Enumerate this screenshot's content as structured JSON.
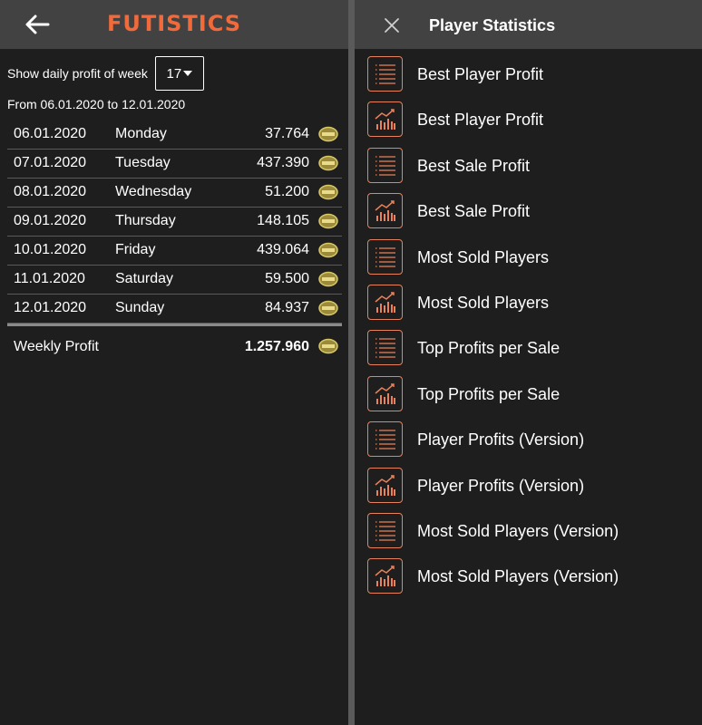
{
  "app": {
    "brand": "FUTISTICS"
  },
  "week": {
    "label": "Show daily profit of week",
    "selected": "17",
    "range": "From 06.01.2020 to 12.01.2020"
  },
  "days": [
    {
      "date": "06.01.2020",
      "day": "Monday",
      "amount": "37.764"
    },
    {
      "date": "07.01.2020",
      "day": "Tuesday",
      "amount": "437.390"
    },
    {
      "date": "08.01.2020",
      "day": "Wednesday",
      "amount": "51.200"
    },
    {
      "date": "09.01.2020",
      "day": "Thursday",
      "amount": "148.105"
    },
    {
      "date": "10.01.2020",
      "day": "Friday",
      "amount": "439.064"
    },
    {
      "date": "11.01.2020",
      "day": "Saturday",
      "amount": "59.500"
    },
    {
      "date": "12.01.2020",
      "day": "Sunday",
      "amount": "84.937"
    }
  ],
  "total": {
    "label": "Weekly Profit",
    "value": "1.257.960"
  },
  "drawer": {
    "title": "Player Statistics",
    "items": [
      {
        "label": "Best Player Profit",
        "icon": "list-icon"
      },
      {
        "label": "Best Player Profit",
        "icon": "chart-icon"
      },
      {
        "label": "Best Sale Profit",
        "icon": "list-icon"
      },
      {
        "label": "Best Sale Profit",
        "icon": "chart-icon"
      },
      {
        "label": "Most Sold Players",
        "icon": "list-icon"
      },
      {
        "label": "Most Sold Players",
        "icon": "chart-icon"
      },
      {
        "label": "Top Profits per Sale",
        "icon": "list-icon"
      },
      {
        "label": "Top Profits per Sale",
        "icon": "chart-icon"
      },
      {
        "label": "Player Profits (Version)",
        "icon": "list-icon"
      },
      {
        "label": "Player Profits (Version)",
        "icon": "chart-icon"
      },
      {
        "label": "Most Sold Players (Version)",
        "icon": "list-icon"
      },
      {
        "label": "Most Sold Players (Version)",
        "icon": "chart-icon"
      }
    ]
  },
  "colors": {
    "accent": "#f26a3a",
    "icon_border": "#e8825a",
    "bar": "#424242",
    "background": "#1e1e1e"
  }
}
